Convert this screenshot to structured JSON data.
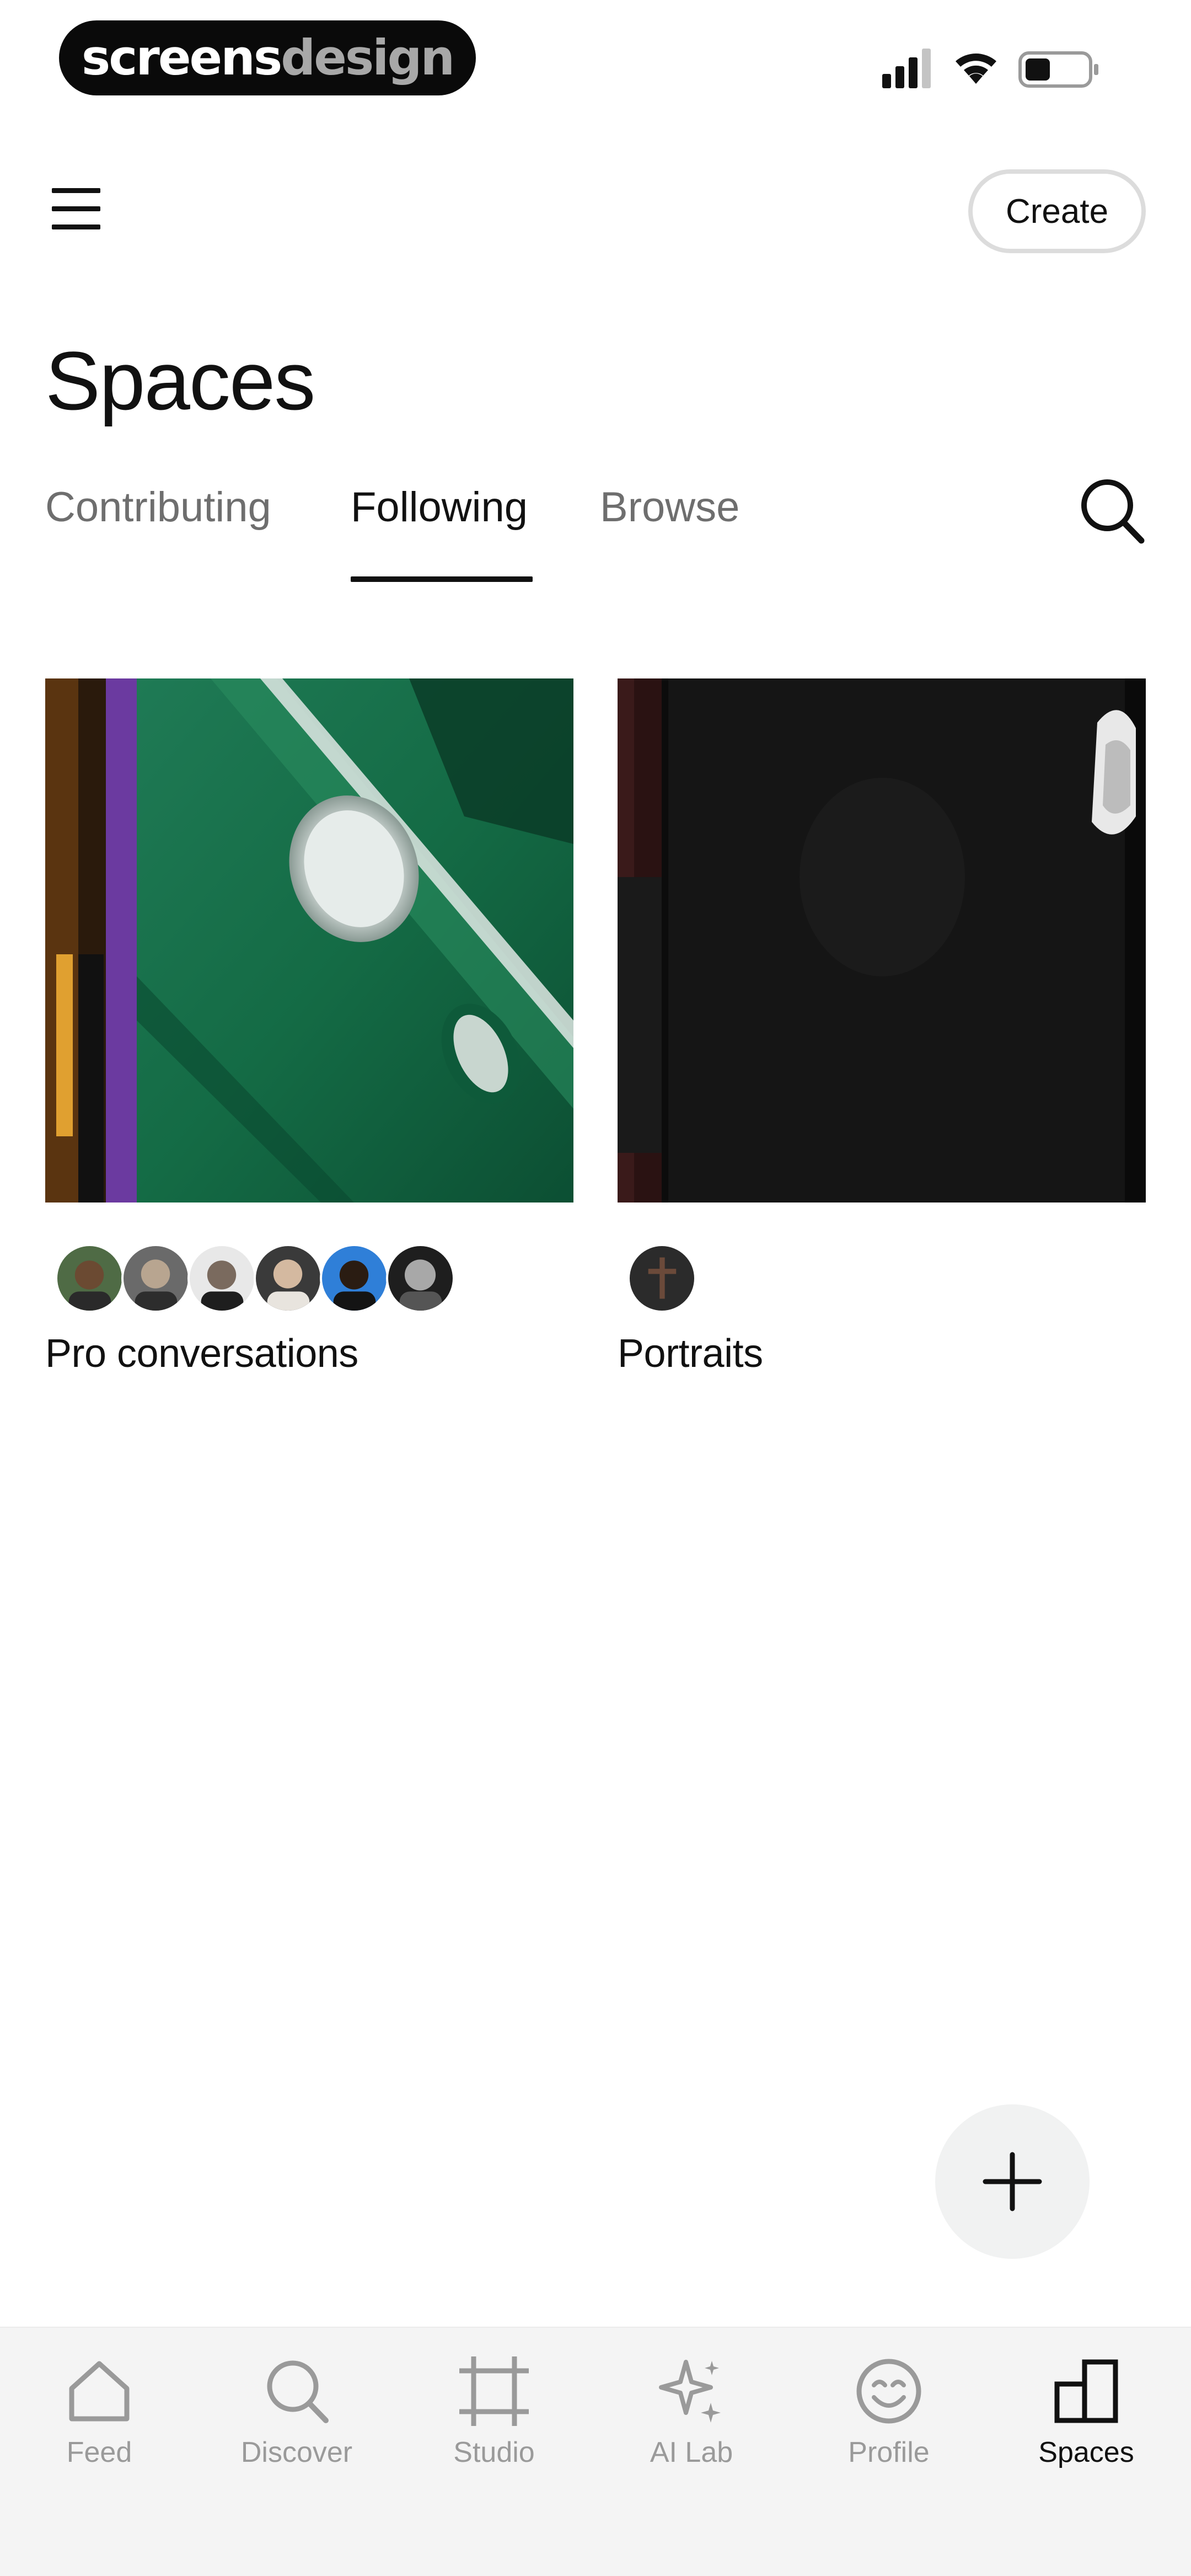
{
  "status_bar": {
    "brand_part1": "screens",
    "brand_part2": "design"
  },
  "header": {
    "menu_icon": "hamburger-menu-icon",
    "create_label": "Create",
    "title": "Spaces"
  },
  "tabs": {
    "items": [
      {
        "label": "Contributing",
        "active": false
      },
      {
        "label": "Following",
        "active": true
      },
      {
        "label": "Browse",
        "active": false
      }
    ],
    "search_icon": "search-icon"
  },
  "spaces": [
    {
      "title": "Pro conversations",
      "member_count_shown": 6
    },
    {
      "title": "Portraits",
      "member_count_shown": 1
    }
  ],
  "fab": {
    "icon": "plus-icon"
  },
  "bottom_nav": {
    "items": [
      {
        "label": "Feed",
        "icon": "home-icon",
        "active": false
      },
      {
        "label": "Discover",
        "icon": "search-icon",
        "active": false
      },
      {
        "label": "Studio",
        "icon": "crop-frame-icon",
        "active": false
      },
      {
        "label": "AI Lab",
        "icon": "sparkles-icon",
        "active": false
      },
      {
        "label": "Profile",
        "icon": "smiley-face-icon",
        "active": false
      },
      {
        "label": "Spaces",
        "icon": "spaces-blocks-icon",
        "active": true
      }
    ]
  },
  "colors": {
    "text_primary": "#111111",
    "text_inactive": "#6e6e6e",
    "nav_inactive": "#9a9a9a",
    "nav_background": "#f4f4f4",
    "fab_background": "#f1f2f2",
    "brand_pill": "#0a0a0a"
  }
}
